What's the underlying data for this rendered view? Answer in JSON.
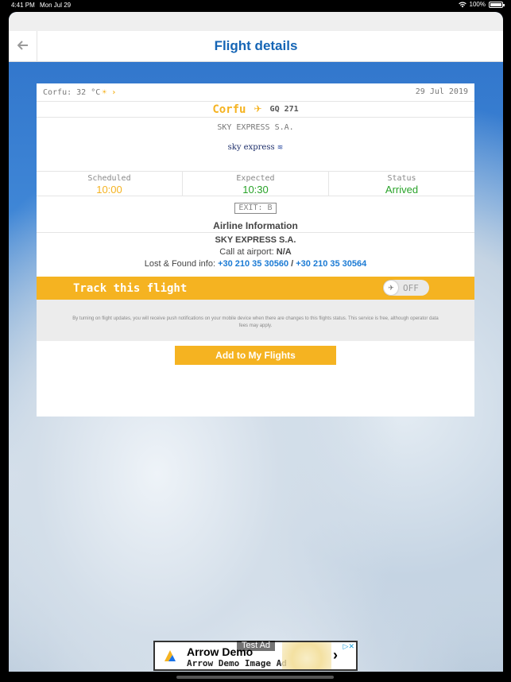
{
  "status_bar": {
    "time": "4:41 PM",
    "date": "Mon Jul 29",
    "battery": "100%"
  },
  "nav": {
    "title": "Flight details",
    "back_icon": "back-arrow-icon"
  },
  "flight": {
    "weather": "Corfu: 32 °C",
    "date": "29 Jul 2019",
    "destination": "Corfu",
    "flight_number": "GQ 271",
    "airline": "SKY EXPRESS S.A.",
    "logo_text": "sky express",
    "scheduled_label": "Scheduled",
    "scheduled_time": "10:00",
    "expected_label": "Expected",
    "expected_time": "10:30",
    "status_label": "Status",
    "status_value": "Arrived",
    "exit": "EXIT:  B"
  },
  "airline_info": {
    "title": "Airline Information",
    "name": "SKY EXPRESS S.A.",
    "call_label": "Call at airport:",
    "call_value": "N/A",
    "lost_label": "Lost & Found info:",
    "phone1": "+30  210 35 30560",
    "separator": " / ",
    "phone2": "+30 210 35 30564"
  },
  "tracking": {
    "label": "Track this flight",
    "toggle_state": "OFF",
    "notice": "By turning on flight updates, you will receive push notifications on your mobile device when there are changes to this flights status. This service is free, although operator data fees may apply."
  },
  "actions": {
    "add_label": "Add to My Flights"
  },
  "ad": {
    "badge": "Test Ad",
    "title": "Arrow Demo",
    "subtitle": "Arrow Demo Image Ad"
  },
  "colors": {
    "accent": "#f5b321",
    "title_blue": "#1565b5",
    "expected_green": "#29a329",
    "link_blue": "#1a7ad4"
  }
}
